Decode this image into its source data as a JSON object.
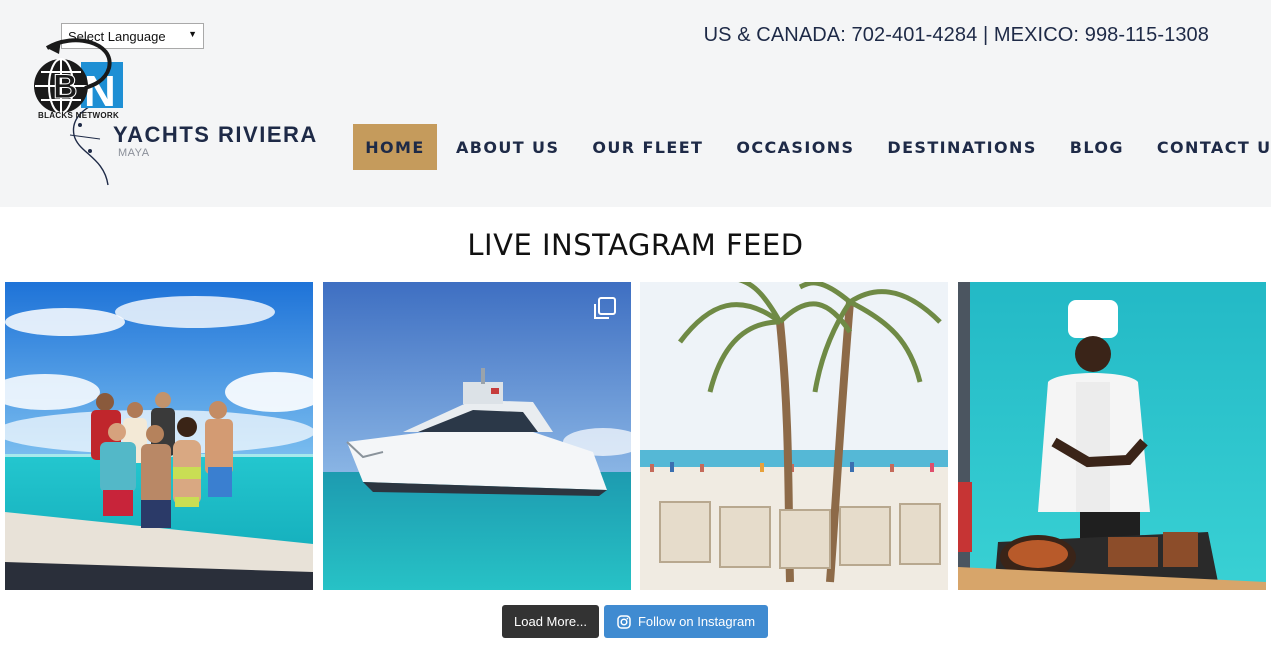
{
  "header": {
    "language_select": "Select Language",
    "phone": "US & CANADA: 702-401-4284 | MEXICO: 998-115-1308",
    "logo_badge_text": "BLACKS NETWORK",
    "brand_name": "YACHTS RIVIERA",
    "brand_sub": "MAYA"
  },
  "nav": {
    "items": [
      {
        "label": "HOME",
        "active": true
      },
      {
        "label": "ABOUT US",
        "active": false
      },
      {
        "label": "OUR FLEET",
        "active": false
      },
      {
        "label": "OCCASIONS",
        "active": false
      },
      {
        "label": "DESTINATIONS",
        "active": false
      },
      {
        "label": "BLOG",
        "active": false
      },
      {
        "label": "CONTACT US",
        "active": false
      }
    ]
  },
  "feed": {
    "title": "LIVE INSTAGRAM FEED",
    "posts": [
      {
        "subject": "group-photo-on-yacht"
      },
      {
        "subject": "yacht-at-sea",
        "is_carousel": true
      },
      {
        "subject": "beach-palm-trees"
      },
      {
        "subject": "chef-grilling-on-deck"
      }
    ],
    "load_more_label": "Load More...",
    "follow_label": "Follow on Instagram"
  },
  "colors": {
    "header_bg": "#f4f5f6",
    "nav_text": "#1e2a47",
    "nav_active_bg": "#c59b5c",
    "load_more_bg": "#333333",
    "follow_bg": "#408bd1"
  }
}
